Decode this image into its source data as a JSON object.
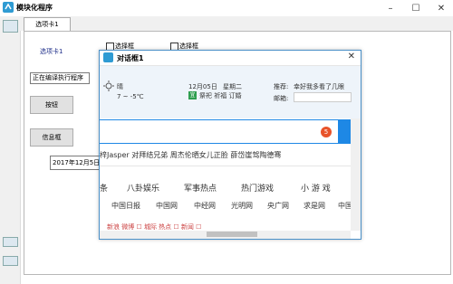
{
  "window": {
    "title": "模块化程序",
    "minimize": "–",
    "maximize": "☐",
    "close": "✕"
  },
  "tab": {
    "label": "选项卡1",
    "panel_label": "选项卡1"
  },
  "checkbox1": {
    "label": "选择框"
  },
  "checkbox2": {
    "label": "选择框"
  },
  "text_field": {
    "value": "正在编译执行程序"
  },
  "button": {
    "label": "按钮"
  },
  "info_button": {
    "label": "信息框"
  },
  "date_field": {
    "value": "2017年12月5日"
  },
  "dialog": {
    "title": "对话框1",
    "close": "✕",
    "weather": {
      "condition": "晴",
      "temp": "7 ~ -5℃"
    },
    "date": "12月05日",
    "weekday": "星期二",
    "almanac_tag": "宜",
    "almanac": "祭祀 祈福 订婚",
    "recommend_label": "推荐:",
    "recommend_text": "幸好我多看了几眼",
    "mail_label": "邮箱:",
    "search_badge": "5",
    "hot_line": "梓Jasper 对拜结兄弟   周杰伦晒女儿正脸   薛岱崖驾陶德骞",
    "categories": [
      "条",
      "八卦娱乐",
      "军事热点",
      "热门游戏",
      "小 游 戏"
    ],
    "sites": [
      "中国日报",
      "中国网",
      "中经网",
      "光明网",
      "央广网",
      "求是网",
      "中国"
    ],
    "bottom_links": "新浪   微博   ☐ 城际   热点   ☐ 新闻   ☐"
  }
}
